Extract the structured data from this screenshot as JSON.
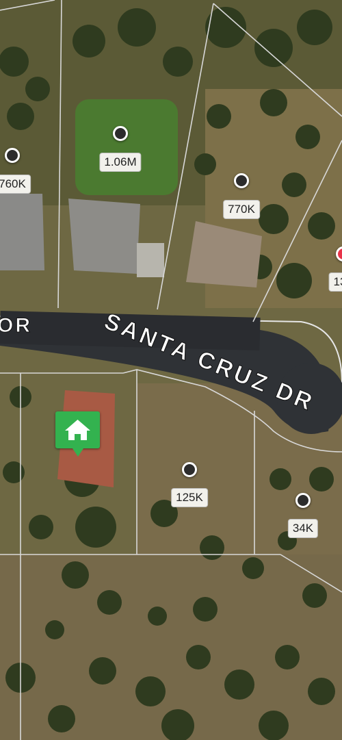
{
  "street": {
    "main_name": "SANTA CRUZ DR",
    "left_fragment": "OR"
  },
  "parcels": [
    {
      "id": "p760",
      "price": "760K",
      "color": "#2c2c2c"
    },
    {
      "id": "p106",
      "price": "1.06M",
      "color": "#2c2c2c"
    },
    {
      "id": "p770",
      "price": "770K",
      "color": "#2c2c2c"
    },
    {
      "id": "p13",
      "price": "13",
      "color": "#e8344a"
    },
    {
      "id": "p125",
      "price": "125K",
      "color": "#2c2c2c"
    },
    {
      "id": "p34",
      "price": "34K",
      "color": "#2c2c2c"
    }
  ],
  "home_marker": {
    "icon": "house-icon",
    "color": "#33b24f"
  }
}
